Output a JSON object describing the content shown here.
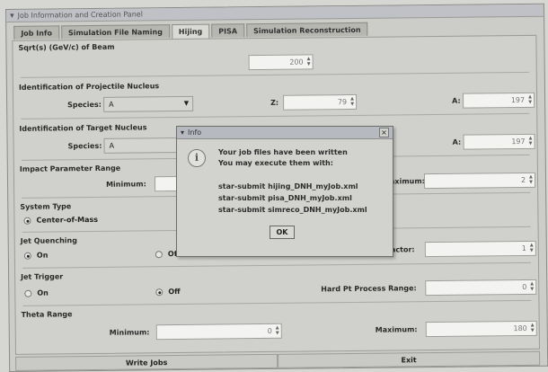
{
  "window": {
    "title": "Job Information and Creation Panel"
  },
  "tabs": [
    {
      "label": "Job Info",
      "active": false
    },
    {
      "label": "Simulation File Naming",
      "active": false
    },
    {
      "label": "Hijing",
      "active": true
    },
    {
      "label": "PISA",
      "active": false
    },
    {
      "label": "Simulation Reconstruction",
      "active": false
    }
  ],
  "form": {
    "beam_energy": {
      "label": "Sqrt(s) (GeV/c) of Beam",
      "value": "200"
    },
    "projectile": {
      "section_label": "Identification of Projectile Nucleus",
      "species_label": "Species:",
      "species_value": "A",
      "z_label": "Z:",
      "z_value": "79",
      "a_label": "A:",
      "a_value": "197"
    },
    "target": {
      "section_label": "Identification of Target Nucleus",
      "species_label": "Species:",
      "species_value": "A",
      "a_label": "A:",
      "a_value": "197"
    },
    "impact": {
      "section_label": "Impact Parameter Range",
      "min_label": "Minimum:",
      "min_value": "",
      "max_label": "Maximum:",
      "max_value": "2"
    },
    "system_type": {
      "section_label": "System Type",
      "option_label": "Center-of-Mass",
      "selected": true
    },
    "jet_quenching": {
      "section_label": "Jet Quenching",
      "on_label": "On",
      "off_label": "Off",
      "selected": "on",
      "eloss_label": "Energy Loss Factor:",
      "eloss_value": "1"
    },
    "jet_trigger": {
      "section_label": "Jet Trigger",
      "on_label": "On",
      "off_label": "Off",
      "selected": "off",
      "pt_label": "Hard Pt Process Range:",
      "pt_value": "0"
    },
    "theta": {
      "section_label": "Theta Range",
      "min_label": "Minimum:",
      "min_value": "0",
      "max_label": "Maximum:",
      "max_value": "180"
    }
  },
  "buttons": {
    "write_jobs": "Write Jobs",
    "exit": "Exit"
  },
  "dialog": {
    "title": "Info",
    "close_glyph": "×",
    "icon_glyph": "i",
    "lines": [
      "Your job files have been written",
      "You may execute them with:",
      "",
      "star-submit hijing_DNH_myJob.xml",
      "star-submit pisa_DNH_myJob.xml",
      "star-submit simreco_DNH_myJob.xml"
    ],
    "ok_label": "OK"
  }
}
